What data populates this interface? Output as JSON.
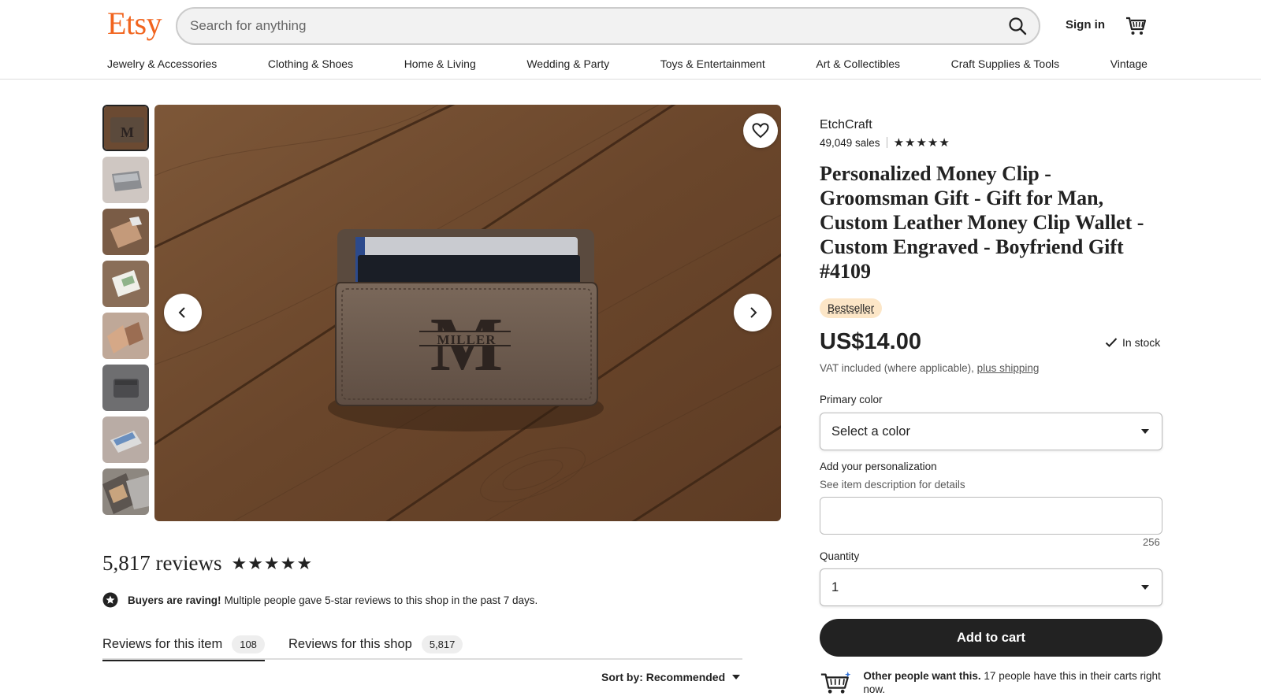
{
  "header": {
    "logo": "Etsy",
    "search_placeholder": "Search for anything",
    "signin_label": "Sign in",
    "brand_color": "#f1641e"
  },
  "categories": [
    "Jewelry & Accessories",
    "Clothing & Shoes",
    "Home & Living",
    "Wedding & Party",
    "Toys & Entertainment",
    "Art & Collectibles",
    "Craft Supplies & Tools",
    "Vintage"
  ],
  "gallery": {
    "monogram_letter": "M",
    "monogram_name": "MILLER",
    "thumbnail_count": 8
  },
  "reviews": {
    "count_label": "5,817 reviews",
    "raving_bold": "Buyers are raving!",
    "raving_text": "Multiple people gave 5-star reviews to this shop in the past 7 days.",
    "tabs": [
      {
        "label": "Reviews for this item",
        "count": "108"
      },
      {
        "label": "Reviews for this shop",
        "count": "5,817"
      }
    ],
    "sort_label": "Sort by: Recommended"
  },
  "listing": {
    "shop_name": "EtchCraft",
    "sales": "49,049 sales",
    "title": "Personalized Money Clip - Groomsman Gift - Gift for Man, Custom Leather Money Clip Wallet - Custom Engraved - Boyfriend Gift #4109",
    "badge": "Bestseller",
    "price": "US$14.00",
    "stock": "In stock",
    "vat_text": "VAT included (where applicable),",
    "shipping_link": "plus shipping",
    "primary_color_label": "Primary color",
    "primary_color_value": "Select a color",
    "personalization_label": "Add your personalization",
    "personalization_hint": "See item description for details",
    "char_count": "256",
    "quantity_label": "Quantity",
    "quantity_value": "1",
    "add_to_cart": "Add to cart",
    "others_bold": "Other people want this.",
    "others_text": "17 people have this in their carts right now."
  }
}
